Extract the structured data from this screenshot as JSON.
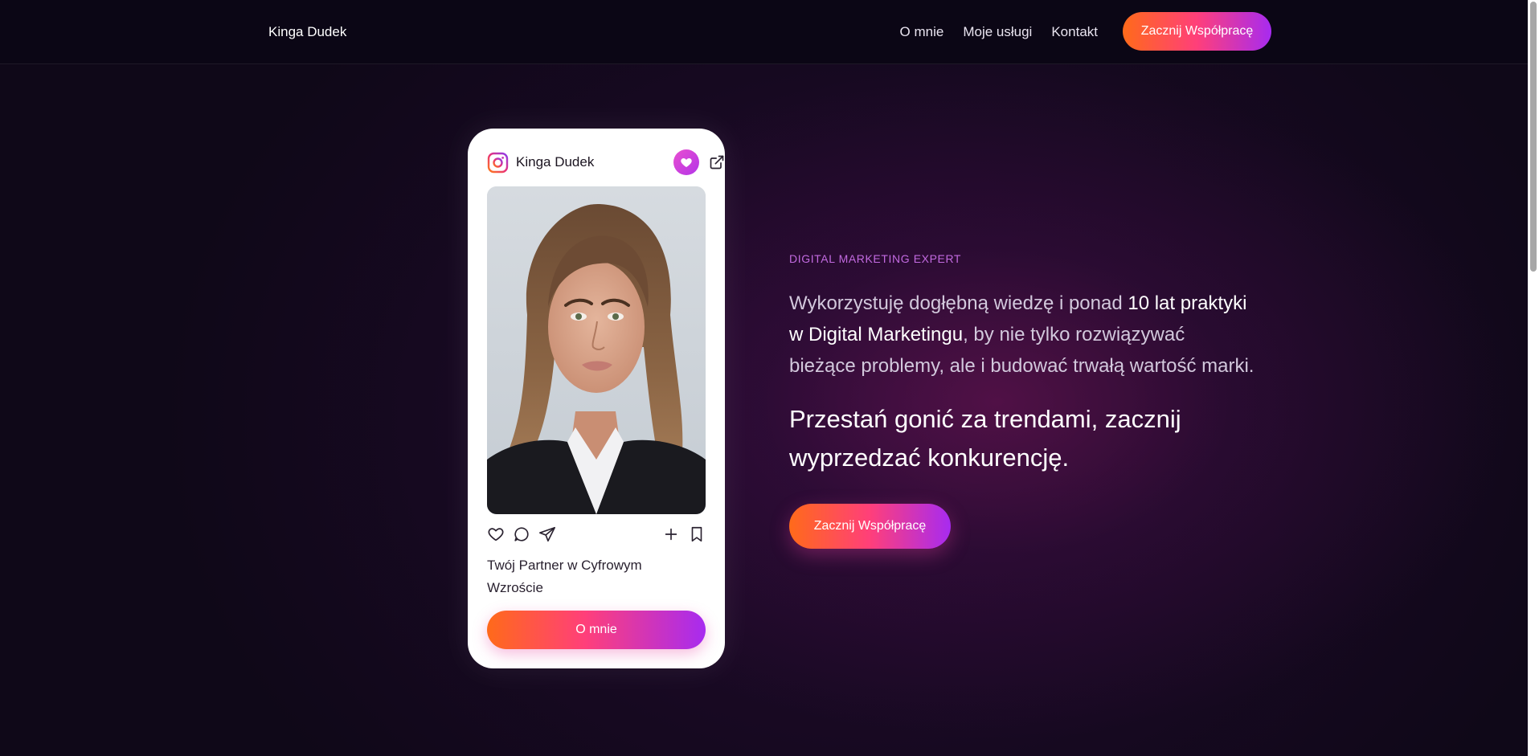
{
  "header": {
    "brand": "Kinga Dudek",
    "nav": [
      "O mnie",
      "Moje usługi",
      "Kontakt"
    ],
    "cta_label": "Zacznij Współpracę"
  },
  "card": {
    "username": "Kinga Dudek",
    "icons": {
      "profile": "instagram-icon",
      "badge": "heart-icon",
      "external": "external-link-icon",
      "actions": [
        "like-icon",
        "comment-icon",
        "share-icon",
        "add-icon",
        "bookmark-icon"
      ]
    },
    "photo": "portrait-photo",
    "caption": "Twój Partner w Cyfrowym Wzroście",
    "button_label": "O mnie"
  },
  "hero": {
    "eyebrow": "DIGITAL MARKETING EXPERT",
    "lead_part1": "Wykorzystuję dogłębną wiedzę i ponad ",
    "lead_bold1": "10 lat praktyki w Digital Marketingu",
    "lead_part2": ", by nie tylko rozwiązywać bieżące problemy, ale i budować trwałą wartość marki.",
    "headline": "Przestań gonić za trendami, zacznij wyprzedzać konkurencję.",
    "cta_label": "Zacznij Współpracę"
  },
  "colors": {
    "background": "#0f0818",
    "accent_orange": "#ff6a1a",
    "accent_pink": "#ff3f7a",
    "accent_purple": "#a72bf0",
    "eyebrow": "#c26ae0"
  }
}
